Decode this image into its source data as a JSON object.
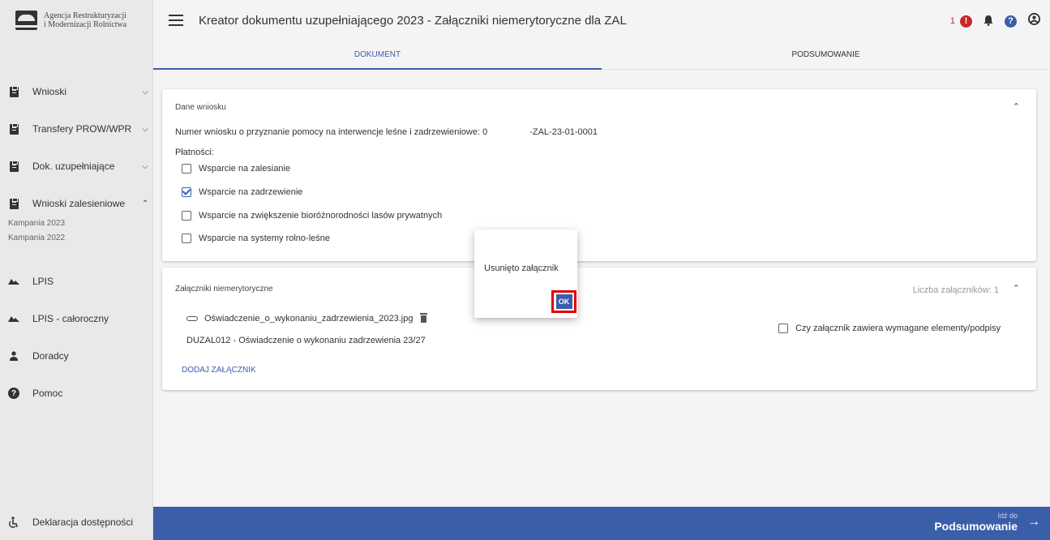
{
  "brand": {
    "line1": "Agencja Restrukturyzacji",
    "line2": "i Modernizacji Rolnictwa"
  },
  "header": {
    "title": "Kreator dokumentu uzupełniającego 2023 - Załączniki niemerytoryczne dla ZAL",
    "notification_count": "1",
    "icons": [
      "menu-icon",
      "alert-icon",
      "bell-icon",
      "help-icon",
      "account-icon"
    ],
    "alert_color": "#c62828",
    "help_color": "#3b5ea8"
  },
  "tabs": [
    {
      "label": "DOKUMENT",
      "active": true
    },
    {
      "label": "PODSUMOWANIE",
      "active": false
    }
  ],
  "sidebar": {
    "items": [
      {
        "label": "Wnioski",
        "icon": "document-icon",
        "chevron": "⌄"
      },
      {
        "label": "Transfery PROW/WPR",
        "icon": "document-icon",
        "chevron": "⌄"
      },
      {
        "label": "Dok. uzupełniające",
        "icon": "document-icon",
        "chevron": "⌄"
      },
      {
        "label": "Wnioski zalesieniowe",
        "icon": "document-icon",
        "chevron": "^"
      },
      {
        "label": "LPIS",
        "icon": "terrain-icon"
      },
      {
        "label": "LPIS - całoroczny",
        "icon": "terrain-icon"
      },
      {
        "label": "Doradcy",
        "icon": "person-icon"
      },
      {
        "label": "Pomoc",
        "icon": "help-icon"
      }
    ],
    "subitems": [
      "Kampania 2023",
      "Kampania 2022"
    ],
    "footer": {
      "label": "Deklaracja dostępności",
      "icon": "accessibility-icon"
    }
  },
  "dane_wniosku": {
    "title": "Dane wniosku",
    "numer_label": "Numer wniosku o przyznanie pomocy na interwencje leśne i zadrzewieniowe: 0",
    "numer_suffix": "-ZAL-23-01-0001",
    "platnosci_label": "Płatności:",
    "checkboxes": [
      {
        "label": "Wsparcie na zalesianie",
        "checked": false
      },
      {
        "label": "Wsparcie na zadrzewienie",
        "checked": true
      },
      {
        "label": "Wsparcie na zwiększenie bioróżnorodności lasów prywatnych",
        "checked": false
      },
      {
        "label": "Wsparcie na systemy rolno-leśne",
        "checked": false
      }
    ]
  },
  "zalaczniki": {
    "title": "Załączniki niemerytoryczne",
    "count_label": "Liczba załączników: 1",
    "file_name": "Oświadczenie_o_wykonaniu_zadrzewienia_2023.jpg",
    "description": "DUZAL012 - Oświadczenie o wykonaniu zadrzewienia 23/27",
    "required_label": "Czy załącznik zawiera wymagane elementy/podpisy",
    "add_label": "DODAJ ZAŁĄCZNIK"
  },
  "bottom": {
    "small": "Idź do",
    "big": "Podsumowanie",
    "arrow": "→"
  },
  "dialog": {
    "message": "Usunięto załącznik",
    "ok_label": "OK"
  }
}
